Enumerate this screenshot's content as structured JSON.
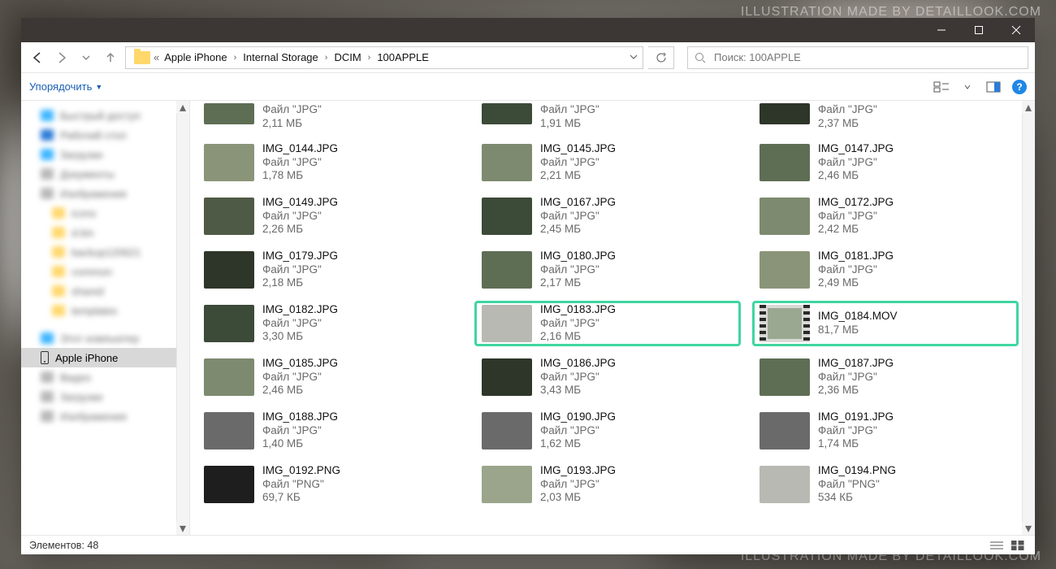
{
  "watermark": "ILLUSTRATION MADE BY DETAILLOOK.COM",
  "breadcrumb": {
    "prefix": "«",
    "segments": [
      "Apple iPhone",
      "Internal Storage",
      "DCIM",
      "100APPLE"
    ]
  },
  "search": {
    "placeholder": "Поиск: 100APPLE"
  },
  "toolbar": {
    "organize": "Упорядочить"
  },
  "sidebar": {
    "items": [
      {
        "label": "Быстрый доступ",
        "color": "#3fb6ff",
        "blurred": true
      },
      {
        "label": "Рабочий стол",
        "color": "#2d7bd8",
        "blurred": true
      },
      {
        "label": "Загрузки",
        "color": "#3fb6ff",
        "blurred": true
      },
      {
        "label": "Документы",
        "color": "#b9b9b9",
        "blurred": true
      },
      {
        "label": "Изображения",
        "color": "#b9b9b9",
        "blurred": true
      },
      {
        "label": "icons",
        "color": "#ffd76b",
        "blurred": true,
        "indent": true
      },
      {
        "label": "d.kin",
        "color": "#ffd76b",
        "blurred": true,
        "indent": true
      },
      {
        "label": "backup120621",
        "color": "#ffd76b",
        "blurred": true,
        "indent": true
      },
      {
        "label": "common",
        "color": "#ffd76b",
        "blurred": true,
        "indent": true
      },
      {
        "label": "shared",
        "color": "#ffd76b",
        "blurred": true,
        "indent": true
      },
      {
        "label": "templates",
        "color": "#ffd76b",
        "blurred": true,
        "indent": true
      },
      {
        "label": "Этот компьютер",
        "color": "#3fb6ff",
        "blurred": true,
        "section": true
      },
      {
        "label": "Apple iPhone",
        "phone": true,
        "selected": true
      },
      {
        "label": "Видео",
        "color": "#b9b9b9",
        "blurred": true
      },
      {
        "label": "Загрузки",
        "color": "#b9b9b9",
        "blurred": true
      },
      {
        "label": "Изображения",
        "color": "#b9b9b9",
        "blurred": true
      }
    ]
  },
  "jpg_label": "Файл \"JPG\"",
  "png_label": "Файл \"PNG\"",
  "files": [
    {
      "name": "",
      "type_key": "jpg_label",
      "size": "2,11 МБ",
      "partial": true,
      "v": "v1"
    },
    {
      "name": "",
      "type_key": "jpg_label",
      "size": "1,91 МБ",
      "partial": true,
      "v": "v3"
    },
    {
      "name": "",
      "type_key": "jpg_label",
      "size": "2,37 МБ",
      "partial": true,
      "v": "v6"
    },
    {
      "name": "IMG_0144.JPG",
      "type_key": "jpg_label",
      "size": "1,78 МБ",
      "v": "v4"
    },
    {
      "name": "IMG_0145.JPG",
      "type_key": "jpg_label",
      "size": "2,21 МБ",
      "v": "v2"
    },
    {
      "name": "IMG_0147.JPG",
      "type_key": "jpg_label",
      "size": "2,46 МБ",
      "v": "v1"
    },
    {
      "name": "IMG_0149.JPG",
      "type_key": "jpg_label",
      "size": "2,26 МБ",
      "v": "v5"
    },
    {
      "name": "IMG_0167.JPG",
      "type_key": "jpg_label",
      "size": "2,45 МБ",
      "v": "v3"
    },
    {
      "name": "IMG_0172.JPG",
      "type_key": "jpg_label",
      "size": "2,42 МБ",
      "v": "v2"
    },
    {
      "name": "IMG_0179.JPG",
      "type_key": "jpg_label",
      "size": "2,18 МБ",
      "v": "v6"
    },
    {
      "name": "IMG_0180.JPG",
      "type_key": "jpg_label",
      "size": "2,17 МБ",
      "v": "v1"
    },
    {
      "name": "IMG_0181.JPG",
      "type_key": "jpg_label",
      "size": "2,49 МБ",
      "v": "v4"
    },
    {
      "name": "IMG_0182.JPG",
      "type_key": "jpg_label",
      "size": "3,30 МБ",
      "v": "v3"
    },
    {
      "name": "IMG_0183.JPG",
      "type_key": "jpg_label",
      "size": "2,16 МБ",
      "v": "v10",
      "hl": true
    },
    {
      "name": "IMG_0184.MOV",
      "type_key": "",
      "size": "81,7 МБ",
      "film": true,
      "hl": true
    },
    {
      "name": "IMG_0185.JPG",
      "type_key": "jpg_label",
      "size": "2,46 МБ",
      "v": "v2"
    },
    {
      "name": "IMG_0186.JPG",
      "type_key": "jpg_label",
      "size": "3,43 МБ",
      "v": "v6"
    },
    {
      "name": "IMG_0187.JPG",
      "type_key": "jpg_label",
      "size": "2,36 МБ",
      "v": "v1"
    },
    {
      "name": "IMG_0188.JPG",
      "type_key": "jpg_label",
      "size": "1,40 МБ",
      "v": "v8"
    },
    {
      "name": "IMG_0190.JPG",
      "type_key": "jpg_label",
      "size": "1,62 МБ",
      "v": "v8"
    },
    {
      "name": "IMG_0191.JPG",
      "type_key": "jpg_label",
      "size": "1,74 МБ",
      "v": "v8"
    },
    {
      "name": "IMG_0192.PNG",
      "type_key": "png_label",
      "size": "69,7 КБ",
      "v": "v9"
    },
    {
      "name": "IMG_0193.JPG",
      "type_key": "jpg_label",
      "size": "2,03 МБ",
      "v": "v7"
    },
    {
      "name": "IMG_0194.PNG",
      "type_key": "png_label",
      "size": "534 КБ",
      "v": "v10"
    }
  ],
  "status": {
    "count_label": "Элементов:",
    "count": "48"
  }
}
